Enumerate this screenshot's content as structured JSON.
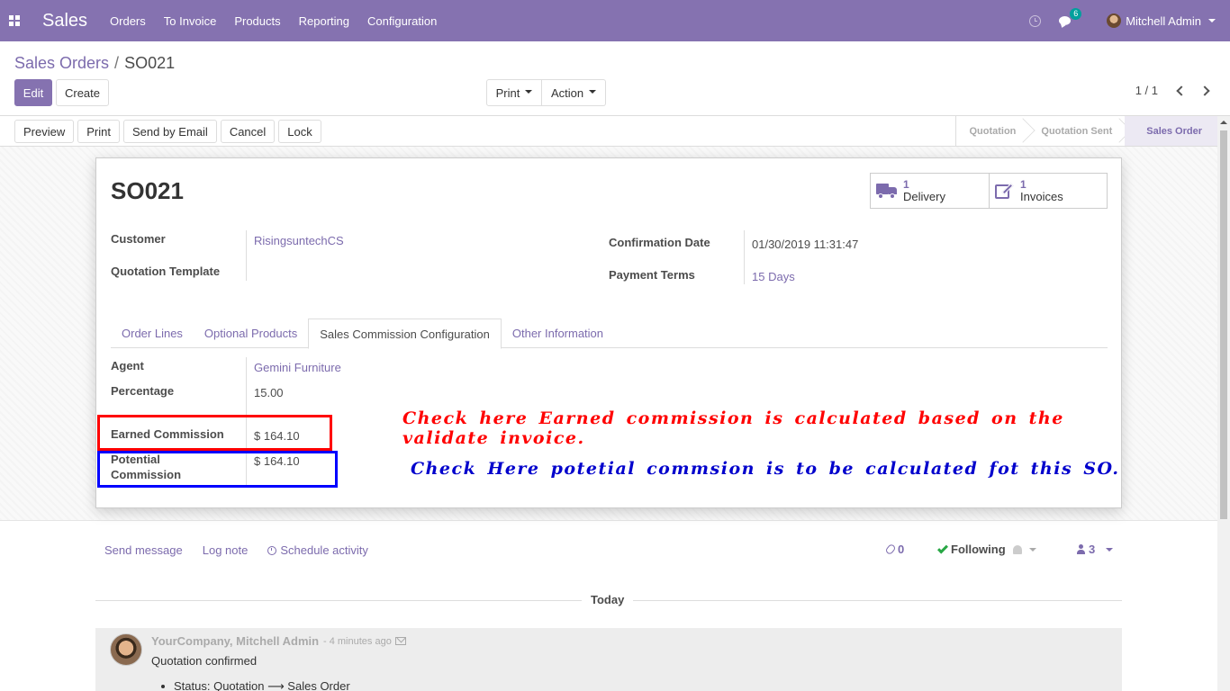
{
  "navbar": {
    "app_name": "Sales",
    "menu": [
      "Orders",
      "To Invoice",
      "Products",
      "Reporting",
      "Configuration"
    ],
    "chat_badge": "6",
    "user": "Mitchell Admin",
    "bg_color": "#8572b0"
  },
  "breadcrumb": {
    "parent": "Sales Orders",
    "separator": "/",
    "current": "SO021"
  },
  "toolbar": {
    "edit": "Edit",
    "create": "Create",
    "print": "Print",
    "action": "Action"
  },
  "pager": {
    "value": "1 / 1"
  },
  "statusbar": {
    "buttons": [
      "Preview",
      "Print",
      "Send by Email",
      "Cancel",
      "Lock"
    ],
    "stages": [
      "Quotation",
      "Quotation Sent",
      "Sales Order"
    ],
    "active_stage": "Sales Order"
  },
  "form": {
    "title": "SO021",
    "smart_buttons": [
      {
        "count": "1",
        "label": "Delivery",
        "icon": "truck-icon"
      },
      {
        "count": "1",
        "label": "Invoices",
        "icon": "edit-icon"
      }
    ],
    "customer_label": "Customer",
    "customer_value": "RisingsuntechCS",
    "quotation_template_label": "Quotation Template",
    "quotation_template_value": "",
    "confirmation_date_label": "Confirmation Date",
    "confirmation_date_value": "01/30/2019 11:31:47",
    "payment_terms_label": "Payment Terms",
    "payment_terms_value": "15 Days",
    "tabs": [
      "Order Lines",
      "Optional Products",
      "Sales Commission Configuration",
      "Other Information"
    ],
    "active_tab": "Sales Commission Configuration",
    "agent_label": "Agent",
    "agent_value": "Gemini Furniture",
    "percentage_label": "Percentage",
    "percentage_value": "15.00",
    "earned_label": "Earned Commission",
    "earned_value": "$ 164.10",
    "potential_label_line1": "Potential",
    "potential_label_line2": "Commission",
    "potential_value": "$ 164.10"
  },
  "annotations": {
    "red_note": "Check here Earned commission is calculated based on the validate invoice.",
    "blue_note": "Check Here potetial commsion is to be calculated fot this SO.",
    "red_color": "#ff0000",
    "blue_color": "#0000cc"
  },
  "chatter": {
    "send_message": "Send message",
    "log_note": "Log note",
    "schedule_activity": "Schedule activity",
    "attachments": "0",
    "following": "Following",
    "followers": "3",
    "today": "Today",
    "message": {
      "author": "YourCompany, Mitchell Admin",
      "time": "- 4 minutes ago",
      "body": "Quotation confirmed",
      "tracking": "Status: Quotation ⟶ Sales Order"
    }
  }
}
